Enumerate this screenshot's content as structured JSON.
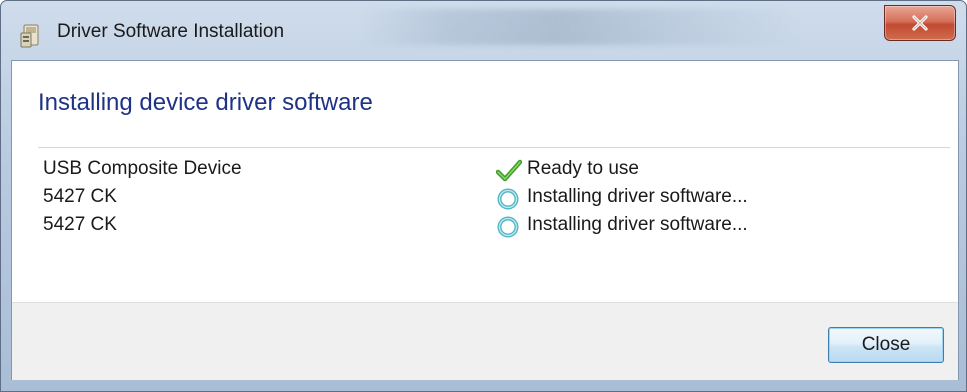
{
  "window": {
    "title": "Driver Software Installation",
    "title_icon": "driver-install-icon",
    "close_icon": "close-icon"
  },
  "main": {
    "heading": "Installing device driver software",
    "devices": [
      {
        "name": "USB Composite Device",
        "status": "Ready to use",
        "status_icon": "checkmark-icon"
      },
      {
        "name": "5427 CK",
        "status": "Installing driver software...",
        "status_icon": "busy-ring-icon"
      },
      {
        "name": "5427 CK",
        "status": "Installing driver software...",
        "status_icon": "busy-ring-icon"
      }
    ]
  },
  "footer": {
    "close_label": "Close"
  },
  "colors": {
    "heading": "#1e3287",
    "close_x_red": "#c24a31",
    "check_green": "#3fa02a",
    "busy_teal": "#4fb5c4",
    "button_border": "#3c7fb1"
  }
}
